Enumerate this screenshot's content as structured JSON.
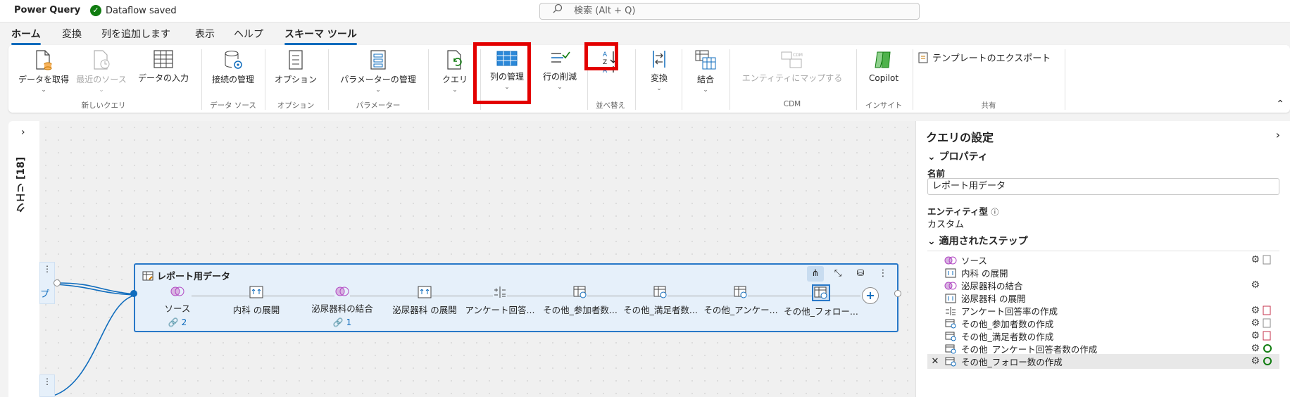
{
  "titlebar": {
    "app_name": "Power Query",
    "saved_status": "Dataflow saved",
    "search_placeholder": "検索 (Alt + Q)"
  },
  "tabs": [
    "ホーム",
    "変換",
    "列を追加します",
    "表示",
    "ヘルプ",
    "スキーマ ツール"
  ],
  "ribbon": {
    "buttons": {
      "get_data": "データを取得",
      "recent_sources": "最近のソース",
      "enter_data": "データの入力",
      "manage_connections": "接続の管理",
      "options": "オプション",
      "manage_parameters": "パラメーターの管理",
      "query": "クエリ",
      "manage_columns": "列の管理",
      "reduce_rows": "行の削減",
      "transform": "変換",
      "combine": "結合",
      "map_to_entity": "エンティティにマップする",
      "copilot": "Copilot",
      "export_template": "テンプレートのエクスポート"
    },
    "groups": {
      "new_query": "新しいクエリ",
      "data_sources": "データ ソース",
      "options": "オプション",
      "parameters": "パラメーター",
      "sort": "並べ替え",
      "cdm": "CDM",
      "insights": "インサイト",
      "share": "共有"
    }
  },
  "left_panel": {
    "label": "クエリ [18]"
  },
  "canvas": {
    "mini_label": "プ",
    "card_title": "レポート用データ",
    "steps": [
      {
        "label": "ソース",
        "link": "2"
      },
      {
        "label": "内科 の展開",
        "link": ""
      },
      {
        "label": "泌尿器科の結合",
        "link": "1"
      },
      {
        "label": "泌尿器科 の展開",
        "link": ""
      },
      {
        "label": "アンケート回答...",
        "link": ""
      },
      {
        "label": "その他_参加者数...",
        "link": ""
      },
      {
        "label": "その他_満足者数...",
        "link": ""
      },
      {
        "label": "その他_アンケー...",
        "link": ""
      },
      {
        "label": "その他_フォロー...",
        "link": ""
      }
    ]
  },
  "settings": {
    "title": "クエリの設定",
    "properties_header": "プロパティ",
    "name_label": "名前",
    "name_value": "レポート用データ",
    "entity_type_label": "エンティティ型",
    "entity_type_value": "カスタム",
    "applied_steps_header": "適用されたステップ",
    "applied_steps": [
      "ソース",
      "内科 の展開",
      "泌尿器科の結合",
      "泌尿器科 の展開",
      "アンケート回答率の作成",
      "その他_参加者数の作成",
      "その他_満足者数の作成",
      "その他_アンケート回答者数の作成",
      "その他_フォロー数の作成"
    ]
  },
  "colors": {
    "accent": "#0f6cbd",
    "highlight": "#e30000",
    "success": "#107c10",
    "merge": "#b146c2"
  }
}
